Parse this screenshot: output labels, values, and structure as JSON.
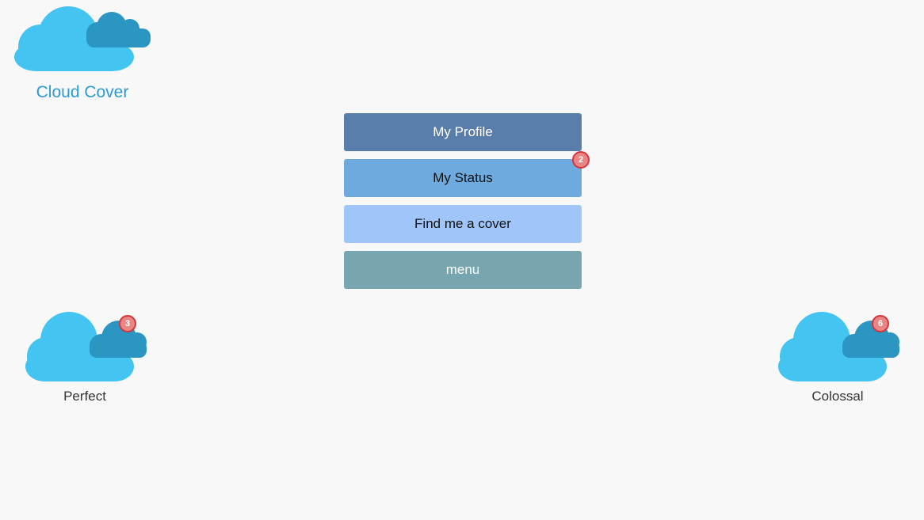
{
  "app": {
    "logo_icon": "cloud-logo-icon",
    "title": "Cloud Cover"
  },
  "menu": {
    "items": [
      {
        "label": "My Profile"
      },
      {
        "label": "My Status",
        "badge": "2"
      },
      {
        "label": "Find me a cover"
      },
      {
        "label": "menu"
      }
    ]
  },
  "clouds": [
    {
      "label": "Perfect",
      "badge": "3",
      "icon": "cloud-icon"
    },
    {
      "label": "Colossal",
      "badge": "6",
      "icon": "cloud-icon"
    }
  ],
  "colors": {
    "brand": "#2a9bd4",
    "cloud_light": "#44c4f1",
    "cloud_dark": "#2a96c1",
    "badge_fill": "#ea8585",
    "badge_border": "#d2363c"
  }
}
